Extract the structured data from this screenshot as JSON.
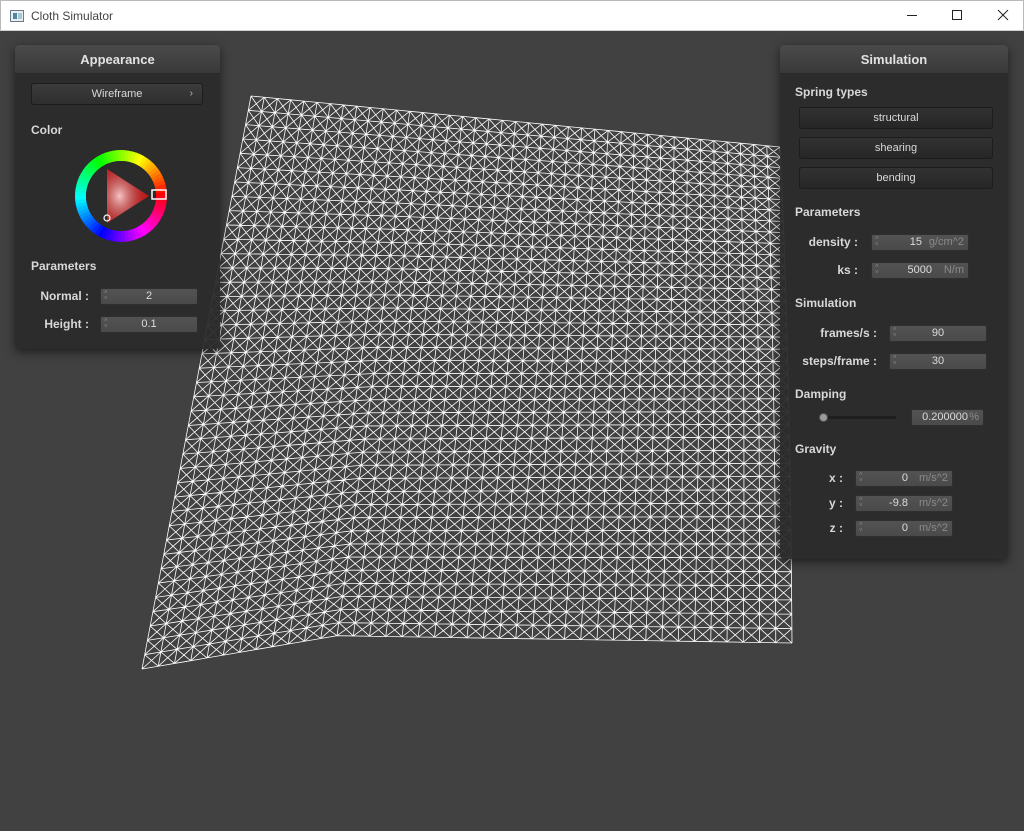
{
  "window": {
    "title": "Cloth Simulator"
  },
  "appearance": {
    "title": "Appearance",
    "render_mode": "Wireframe",
    "color_label": "Color",
    "parameters_label": "Parameters",
    "normal": {
      "label": "Normal :",
      "value": "2"
    },
    "height": {
      "label": "Height :",
      "value": "0.1"
    }
  },
  "simulation": {
    "title": "Simulation",
    "spring_types_label": "Spring types",
    "spring_types": [
      "structural",
      "shearing",
      "bending"
    ],
    "parameters_label": "Parameters",
    "density": {
      "label": "density :",
      "value": "15",
      "unit": "g/cm^2"
    },
    "ks": {
      "label": "ks :",
      "value": "5000",
      "unit": "N/m"
    },
    "simulation_label": "Simulation",
    "frames_per_second": {
      "label": "frames/s :",
      "value": "90"
    },
    "steps_per_frame": {
      "label": "steps/frame :",
      "value": "30"
    },
    "damping_label": "Damping",
    "damping": {
      "value": "0.200000",
      "unit": "%",
      "slider_fraction": 0.0
    },
    "gravity_label": "Gravity",
    "gravity": [
      {
        "label": "x :",
        "value": "0",
        "unit": "m/s^2"
      },
      {
        "label": "y :",
        "value": "-9.8",
        "unit": "m/s^2"
      },
      {
        "label": "z :",
        "value": "0",
        "unit": "m/s^2"
      }
    ]
  },
  "cloth": {
    "render": "wireframe",
    "grid_divisions": 40,
    "line_color": "#ffffff"
  },
  "colors": {
    "background": "#414141",
    "panel": "#2b2b2b",
    "selected_hue": "#ff0000"
  }
}
